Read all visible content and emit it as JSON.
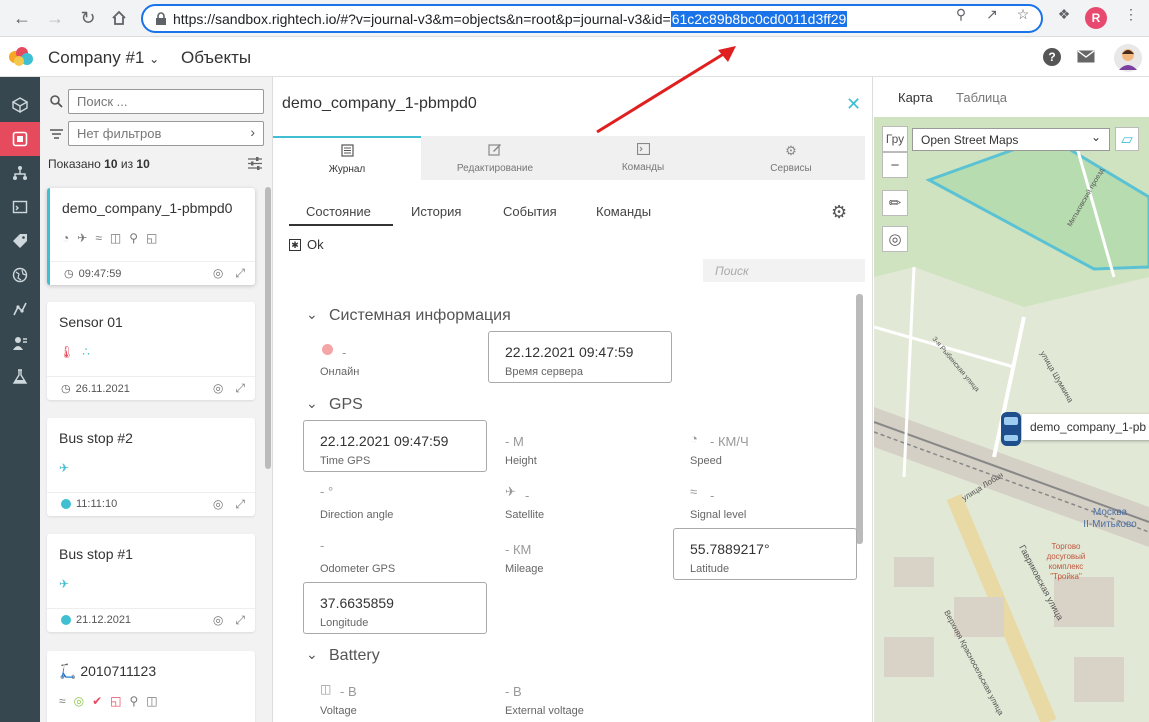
{
  "browser": {
    "url_prefix": "https://sandbox.rightech.io/#?v=journal-v3&m=objects&n=root&p=journal-v3&id=",
    "url_selected": "61c2c89b8bc0cd0011d3ff29",
    "profile_initial": "R"
  },
  "header": {
    "company": "Company #1",
    "section": "Объекты"
  },
  "list": {
    "search_placeholder": "Поиск ...",
    "filter_label": "Нет фильтров",
    "shown_prefix": "Показано ",
    "shown_count": "10",
    "shown_mid": " из ",
    "shown_total": "10",
    "cards": [
      {
        "title": "demo_company_1-pbmpd0",
        "time": "09:47:59"
      },
      {
        "title": "Sensor 01",
        "time": "26.11.2021"
      },
      {
        "title": "Bus stop #2",
        "time": "11:11:10"
      },
      {
        "title": "Bus stop #1",
        "time": "21.12.2021"
      },
      {
        "title": "2010711123",
        "time": ""
      }
    ]
  },
  "detail": {
    "title": "demo_company_1-pbmpd0",
    "tabs": [
      "Журнал",
      "Редактирование",
      "Команды",
      "Сервисы"
    ],
    "subtabs": [
      "Состояние",
      "История",
      "События",
      "Команды"
    ],
    "status": "Ok",
    "search_placeholder": "Поиск",
    "groups": {
      "system": "Системная информация",
      "gps": "GPS",
      "battery": "Battery"
    },
    "system_props": [
      {
        "value": "-",
        "label": "Онлайн"
      },
      {
        "value": "22.12.2021 09:47:59",
        "label": "Время сервера"
      }
    ],
    "gps_props": [
      {
        "value": "22.12.2021 09:47:59",
        "label": "Time GPS"
      },
      {
        "value": "- М",
        "label": "Height"
      },
      {
        "value": "- КМ/Ч",
        "label": "Speed"
      },
      {
        "value": "- °",
        "label": "Direction angle"
      },
      {
        "value": "-",
        "label": "Satellite"
      },
      {
        "value": "-",
        "label": "Signal level"
      },
      {
        "value": "-",
        "label": "Odometer GPS"
      },
      {
        "value": "- КМ",
        "label": "Mileage"
      },
      {
        "value": "55.7889217°",
        "label": "Latitude"
      },
      {
        "value": "37.6635859",
        "label": "Longitude"
      }
    ],
    "battery_props": [
      {
        "value": "- В",
        "label": "Voltage"
      },
      {
        "value": "- В",
        "label": "External voltage"
      }
    ]
  },
  "map": {
    "tabs": [
      "Карта",
      "Таблица"
    ],
    "layer": "Open Street Maps",
    "partial_label": "Гру",
    "marker_label": "demo_company_1-pb",
    "station_name": "Москва\nII-Митьково",
    "poi_name": "Торгово\nдосуговый\nкомплекс\n\"Тройка\"",
    "streets": [
      "Гавриковская улица",
      "улица Шумкина",
      "улица Лобач",
      "Верхняя Красносельская улица",
      "3-я Рыбинская улица",
      "Митьковский проезд"
    ]
  },
  "colors": {
    "accent": "#3fbfd1",
    "rail_active": "#e64a5d",
    "rail": "#37474f"
  }
}
